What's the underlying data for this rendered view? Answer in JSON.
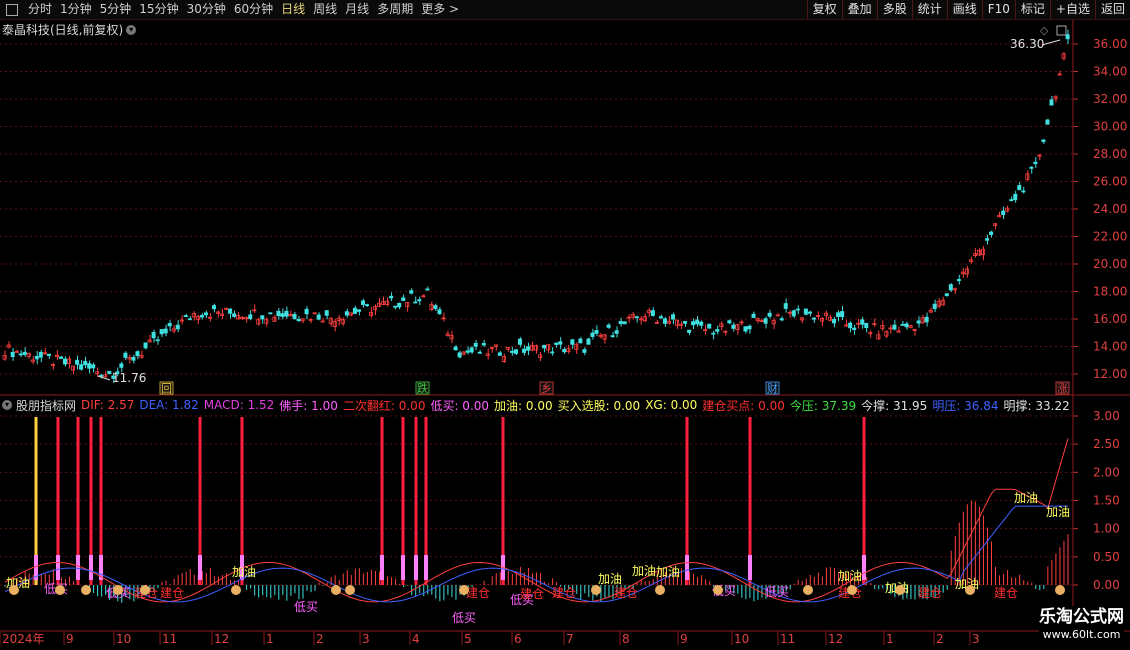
{
  "toolbar": {
    "periods": [
      {
        "label": "分时",
        "active": false
      },
      {
        "label": "1分钟",
        "active": false
      },
      {
        "label": "5分钟",
        "active": false
      },
      {
        "label": "15分钟",
        "active": false
      },
      {
        "label": "30分钟",
        "active": false
      },
      {
        "label": "60分钟",
        "active": false
      },
      {
        "label": "日线",
        "active": true
      },
      {
        "label": "周线",
        "active": false
      },
      {
        "label": "月线",
        "active": false
      },
      {
        "label": "多周期",
        "active": false
      },
      {
        "label": "更多",
        "active": false
      }
    ],
    "buttons": [
      "复权",
      "叠加",
      "多股",
      "统计",
      "画线",
      "F10",
      "标记",
      "+自选",
      "返回"
    ]
  },
  "stock": {
    "title": "泰晶科技(日线,前复权)"
  },
  "price_axis": {
    "ticks": [
      "36.00",
      "34.00",
      "32.00",
      "30.00",
      "28.00",
      "26.00",
      "24.00",
      "22.00",
      "20.00",
      "18.00",
      "16.00",
      "14.00",
      "12.00"
    ]
  },
  "price_annotations": {
    "high": "36.30",
    "low": "11.76"
  },
  "event_markers": [
    {
      "label": "回",
      "color": "#e8c040"
    },
    {
      "label": "跌",
      "color": "#40d040"
    },
    {
      "label": "乡",
      "color": "#e04040"
    },
    {
      "label": "财",
      "color": "#40a0ff"
    },
    {
      "label": "涨",
      "color": "#e04040"
    }
  ],
  "indicator": {
    "name": "股朋指标网",
    "values": [
      {
        "text": "DIF: 2.57",
        "color": "#ff4040"
      },
      {
        "text": "DEA: 1.82",
        "color": "#4060ff"
      },
      {
        "text": "MACD: 1.52",
        "color": "#e040e0"
      },
      {
        "text": "佛手: 1.00",
        "color": "#ff60ff"
      },
      {
        "text": "二次翻红: 0.00",
        "color": "#ff3030"
      },
      {
        "text": "低买: 0.00",
        "color": "#ff60ff"
      },
      {
        "text": "加油: 0.00",
        "color": "#ffff60"
      },
      {
        "text": "买入选股: 0.00",
        "color": "#ffff60"
      },
      {
        "text": "XG: 0.00",
        "color": "#ffff60"
      },
      {
        "text": "建仓买点: 0.00",
        "color": "#ff3030"
      },
      {
        "text": "今压: 37.39",
        "color": "#40e040"
      },
      {
        "text": "今撑: 31.95",
        "color": "#e0e0e0"
      },
      {
        "text": "明压: 36.84",
        "color": "#4060ff"
      },
      {
        "text": "明撑: 33.22",
        "color": "#e0e0e0"
      }
    ]
  },
  "indicator_axis": {
    "ticks": [
      "3.00",
      "2.50",
      "2.00",
      "1.50",
      "1.00",
      "0.50",
      "0.00"
    ]
  },
  "signal_labels": [
    {
      "text": "加油",
      "color": "#ffff60"
    },
    {
      "text": "低买",
      "color": "#ff60ff"
    },
    {
      "text": "建仓",
      "color": "#ff3030"
    }
  ],
  "time_axis": {
    "labels": [
      "2024年",
      "9",
      "10",
      "11",
      "12",
      "1",
      "2",
      "3",
      "4",
      "5",
      "6",
      "7",
      "8",
      "9",
      "10",
      "11",
      "12",
      "1",
      "2",
      "3"
    ]
  },
  "watermark": {
    "title": "乐淘公式网",
    "url": "www.60lt.com"
  },
  "colors": {
    "up": "#ff4040",
    "down": "#40e0e0",
    "dif": "#ff4040",
    "dea": "#4060ff",
    "grid": "#5a1010"
  }
}
